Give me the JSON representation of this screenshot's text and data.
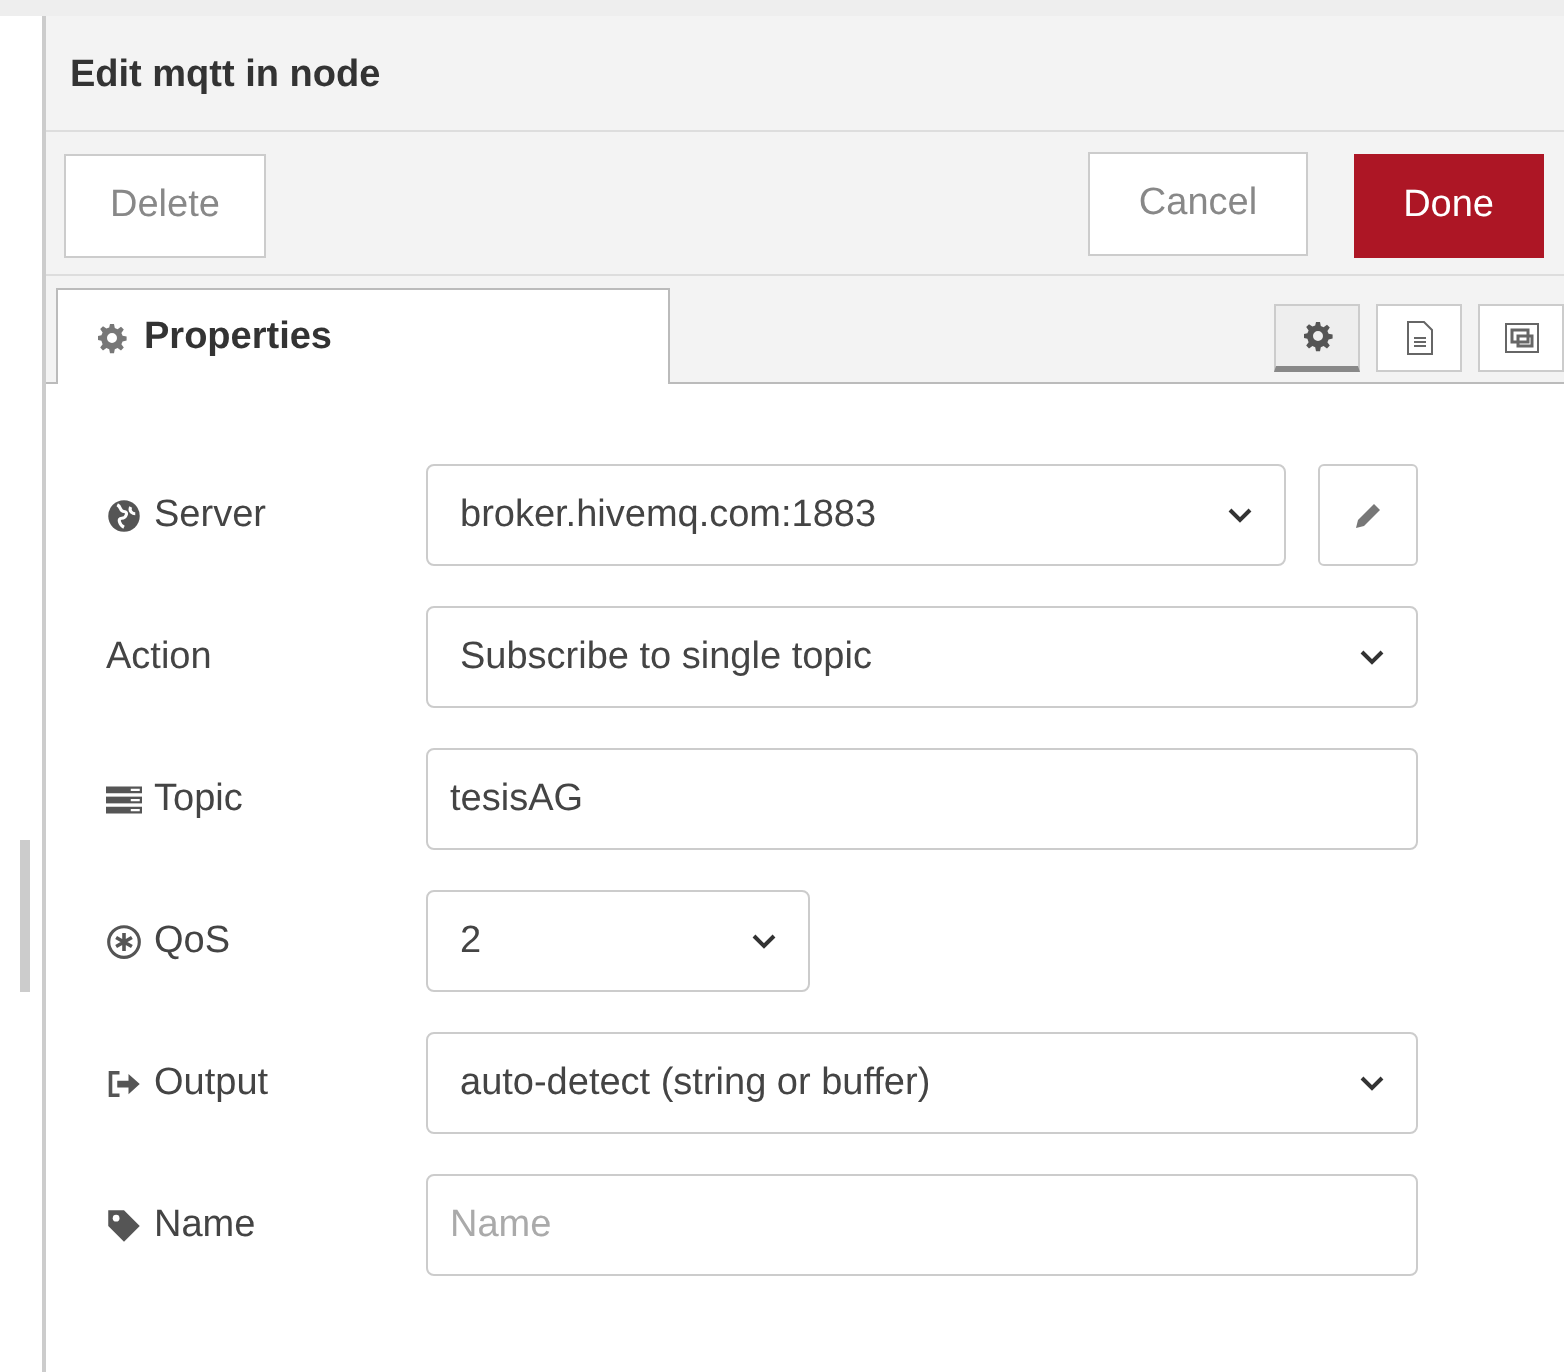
{
  "dialog": {
    "title": "Edit mqtt in node"
  },
  "buttons": {
    "delete": "Delete",
    "cancel": "Cancel",
    "done": "Done"
  },
  "tabs": [
    {
      "label": "Properties",
      "selected": true
    }
  ],
  "tab_tools": [
    {
      "selected": true
    },
    {
      "selected": false
    },
    {
      "selected": false
    }
  ],
  "fields": [
    {
      "label": "Server",
      "kind": "select",
      "value": "broker.hivemq.com:1883",
      "edit_button": true
    },
    {
      "label": "Action",
      "kind": "select",
      "value": "Subscribe to single topic"
    },
    {
      "label": "Topic",
      "kind": "input",
      "value": "tesisAG"
    },
    {
      "label": "QoS",
      "kind": "select-small",
      "value": "2"
    },
    {
      "label": "Output",
      "kind": "select",
      "value": "auto-detect (string or buffer)"
    },
    {
      "label": "Name",
      "kind": "input",
      "placeholder": "Name"
    }
  ]
}
